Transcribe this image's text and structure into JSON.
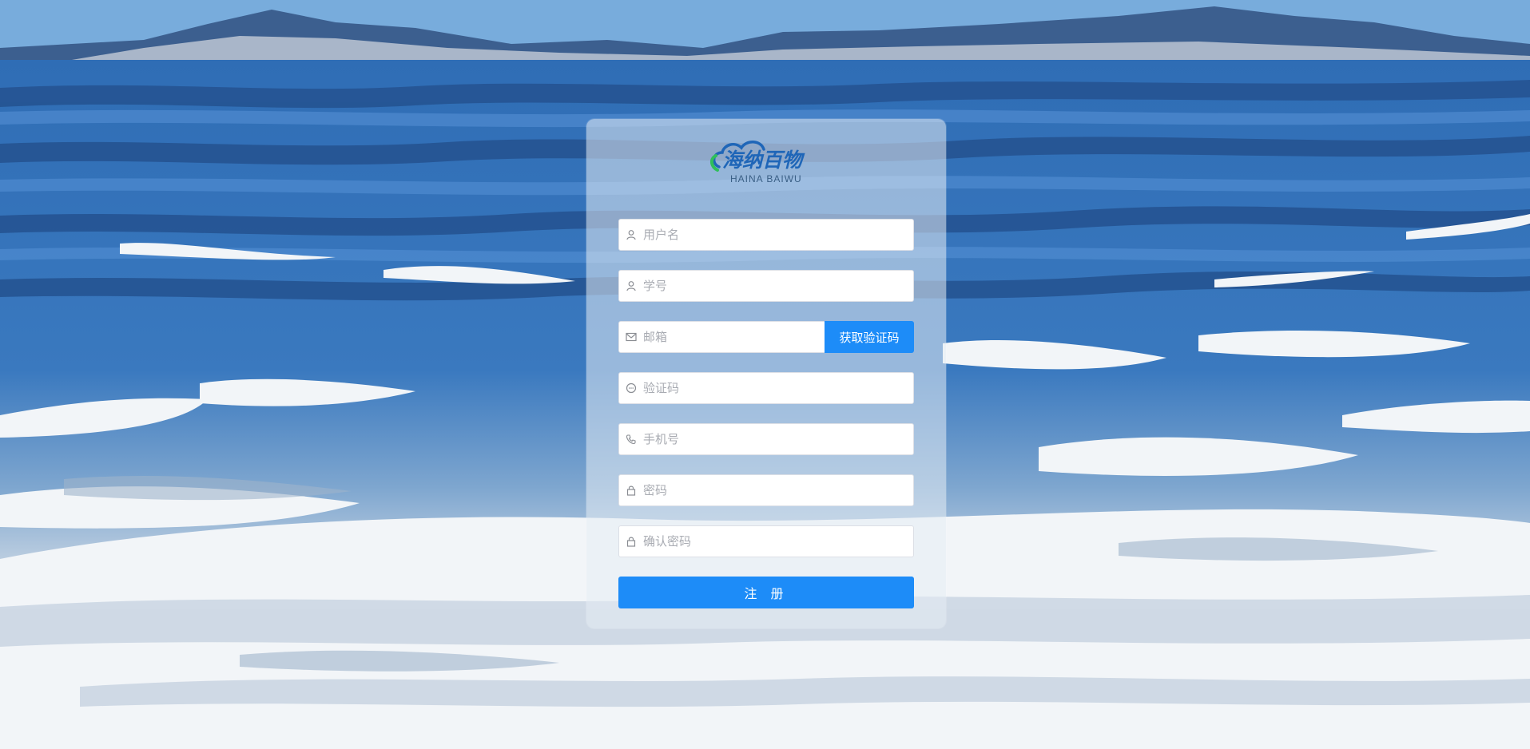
{
  "logo": {
    "name_cn": "海纳百物",
    "name_en": "HAINA BAIWU"
  },
  "form": {
    "username": {
      "placeholder": "用户名",
      "icon": "user-icon"
    },
    "student_id": {
      "placeholder": "学号",
      "icon": "user-icon"
    },
    "email": {
      "placeholder": "邮箱",
      "icon": "mail-icon"
    },
    "get_code_label": "获取验证码",
    "code": {
      "placeholder": "验证码",
      "icon": "chat-bubble-icon"
    },
    "phone": {
      "placeholder": "手机号",
      "icon": "phone-icon"
    },
    "password": {
      "placeholder": "密码",
      "icon": "lock-icon"
    },
    "confirm_password": {
      "placeholder": "确认密码",
      "icon": "lock-icon"
    },
    "submit_label": "注 册"
  },
  "colors": {
    "primary": "#1d8cf8",
    "sea_dark": "#2a5c97",
    "sea_mid": "#3c78bd",
    "foam": "#eef2f6",
    "sky": "#76a9d9"
  }
}
